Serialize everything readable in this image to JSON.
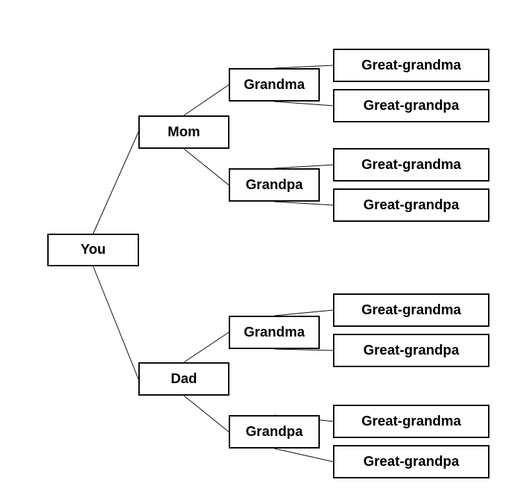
{
  "diagram": {
    "type": "family-tree",
    "colors": {
      "background": "#ffffff",
      "border": "#000000",
      "text": "#000000",
      "line": "#000000"
    },
    "root": {
      "id": "you",
      "label": "You"
    },
    "parents": [
      {
        "id": "mom",
        "label": "Mom",
        "grandparents": [
          {
            "id": "mom-grandma",
            "label": "Grandma",
            "great_grandparents": [
              {
                "id": "mom-grandma-ggma",
                "label": "Great-grandma"
              },
              {
                "id": "mom-grandma-ggpa",
                "label": "Great-grandpa"
              }
            ]
          },
          {
            "id": "mom-grandpa",
            "label": "Grandpa",
            "great_grandparents": [
              {
                "id": "mom-grandpa-ggma",
                "label": "Great-grandma"
              },
              {
                "id": "mom-grandpa-ggpa",
                "label": "Great-grandpa"
              }
            ]
          }
        ]
      },
      {
        "id": "dad",
        "label": "Dad",
        "grandparents": [
          {
            "id": "dad-grandma",
            "label": "Grandma",
            "great_grandparents": [
              {
                "id": "dad-grandma-ggma",
                "label": "Great-grandma"
              },
              {
                "id": "dad-grandma-ggpa",
                "label": "Great-grandpa"
              }
            ]
          },
          {
            "id": "dad-grandpa",
            "label": "Grandpa",
            "great_grandparents": [
              {
                "id": "dad-grandpa-ggma",
                "label": "Great-grandma"
              },
              {
                "id": "dad-grandpa-ggpa",
                "label": "Great-grandpa"
              }
            ]
          }
        ]
      }
    ]
  }
}
